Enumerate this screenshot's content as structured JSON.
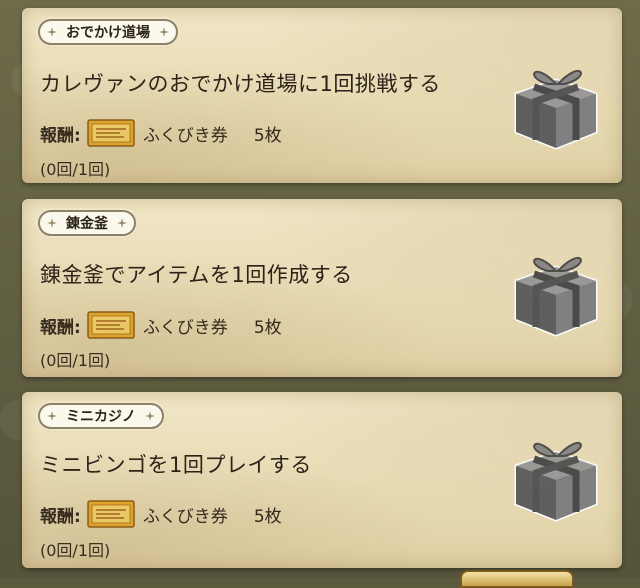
{
  "quests": [
    {
      "tag": "おでかけ道場",
      "title": "カレヴァンのおでかけ道場に1回挑戦する",
      "reward_label": "報酬:",
      "reward_item": "ふくびき券",
      "reward_qty": "5枚",
      "progress": "(0回/1回)",
      "icon": "gift-box-icon"
    },
    {
      "tag": "錬金釜",
      "title": "錬金釜でアイテムを1回作成する",
      "reward_label": "報酬:",
      "reward_item": "ふくびき券",
      "reward_qty": "5枚",
      "progress": "(0回/1回)",
      "icon": "gift-box-icon"
    },
    {
      "tag": "ミニカジノ",
      "title": "ミニビンゴを1回プレイする",
      "reward_label": "報酬:",
      "reward_item": "ふくびき券",
      "reward_qty": "5枚",
      "progress": "(0回/1回)",
      "icon": "gift-box-icon"
    }
  ],
  "colors": {
    "card": "#ece0ba",
    "text": "#2a2118",
    "ticket": "#e6a82a",
    "gift": "#7d7d7d"
  }
}
